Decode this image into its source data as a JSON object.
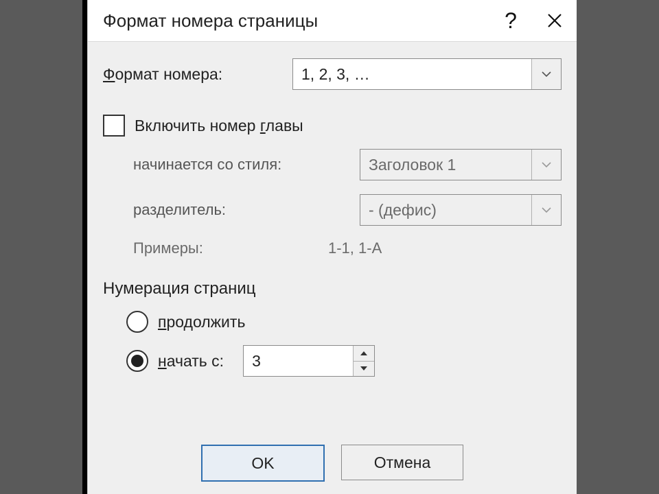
{
  "title": "Формат номера страницы",
  "format": {
    "label_u": "Ф",
    "label_rest": "ормат номера:",
    "value": "1, 2, 3, …"
  },
  "chapter": {
    "label_pre": "Включить номер ",
    "label_u": "г",
    "label_post": "лавы",
    "starts_with_label": "начинается со стиля:",
    "starts_with_value": "Заголовок 1",
    "separator_label": "разделитель:",
    "separator_value": "-    (дефис)",
    "examples_label": "Примеры:",
    "examples_value": "1-1, 1-A"
  },
  "numbering": {
    "group_label": "Нумерация страниц",
    "continue_u": "п",
    "continue_rest": "родолжить",
    "startat_u": "н",
    "startat_rest": "ачать с:",
    "startat_value": "3"
  },
  "buttons": {
    "ok": "OK",
    "cancel": "Отмена"
  }
}
